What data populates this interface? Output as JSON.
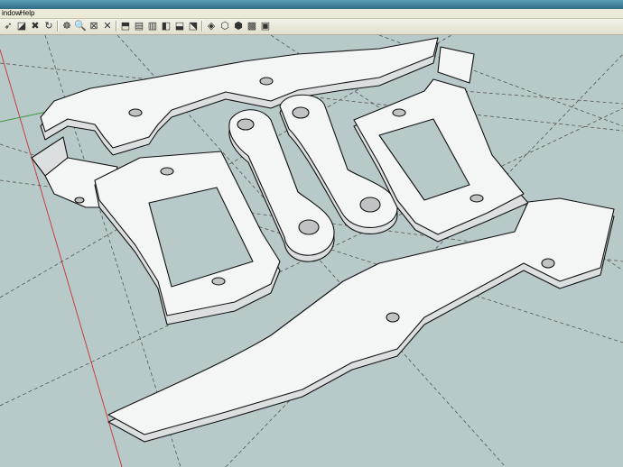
{
  "app": {
    "menu": [
      {
        "key": "window",
        "label": "indow"
      },
      {
        "key": "help",
        "label": "Help"
      }
    ]
  },
  "toolbar": {
    "tools": [
      {
        "name": "select-icon",
        "glyph": "➶"
      },
      {
        "name": "eraser-icon",
        "glyph": "◪"
      },
      {
        "name": "paint-bucket-icon",
        "glyph": "✖"
      },
      {
        "name": "orbit-icon",
        "glyph": "↻"
      },
      {
        "name": "pan-icon",
        "glyph": "☸"
      },
      {
        "name": "zoom-icon",
        "glyph": "🔍"
      },
      {
        "name": "zoom-window-icon",
        "glyph": "⊠"
      },
      {
        "name": "zoom-extents-icon",
        "glyph": "✕"
      },
      {
        "name": "iso-view-icon",
        "glyph": "⬒"
      },
      {
        "name": "top-view-icon",
        "glyph": "▤"
      },
      {
        "name": "front-view-icon",
        "glyph": "▥"
      },
      {
        "name": "right-view-icon",
        "glyph": "◧"
      },
      {
        "name": "back-view-icon",
        "glyph": "⬓"
      },
      {
        "name": "left-view-icon",
        "glyph": "⬔"
      },
      {
        "name": "xray-icon",
        "glyph": "◈"
      },
      {
        "name": "wireframe-icon",
        "glyph": "⬡"
      },
      {
        "name": "shaded-icon",
        "glyph": "⬢"
      },
      {
        "name": "textured-icon",
        "glyph": "▩"
      },
      {
        "name": "monochrome-icon",
        "glyph": "▣"
      }
    ]
  },
  "colors": {
    "background": "#b8c9c9",
    "part_face": "#f4f6f6",
    "part_side": "#dcdfdf",
    "edge": "#111111",
    "axis_red": "#c84040",
    "axis_green": "#3e9a3e"
  }
}
